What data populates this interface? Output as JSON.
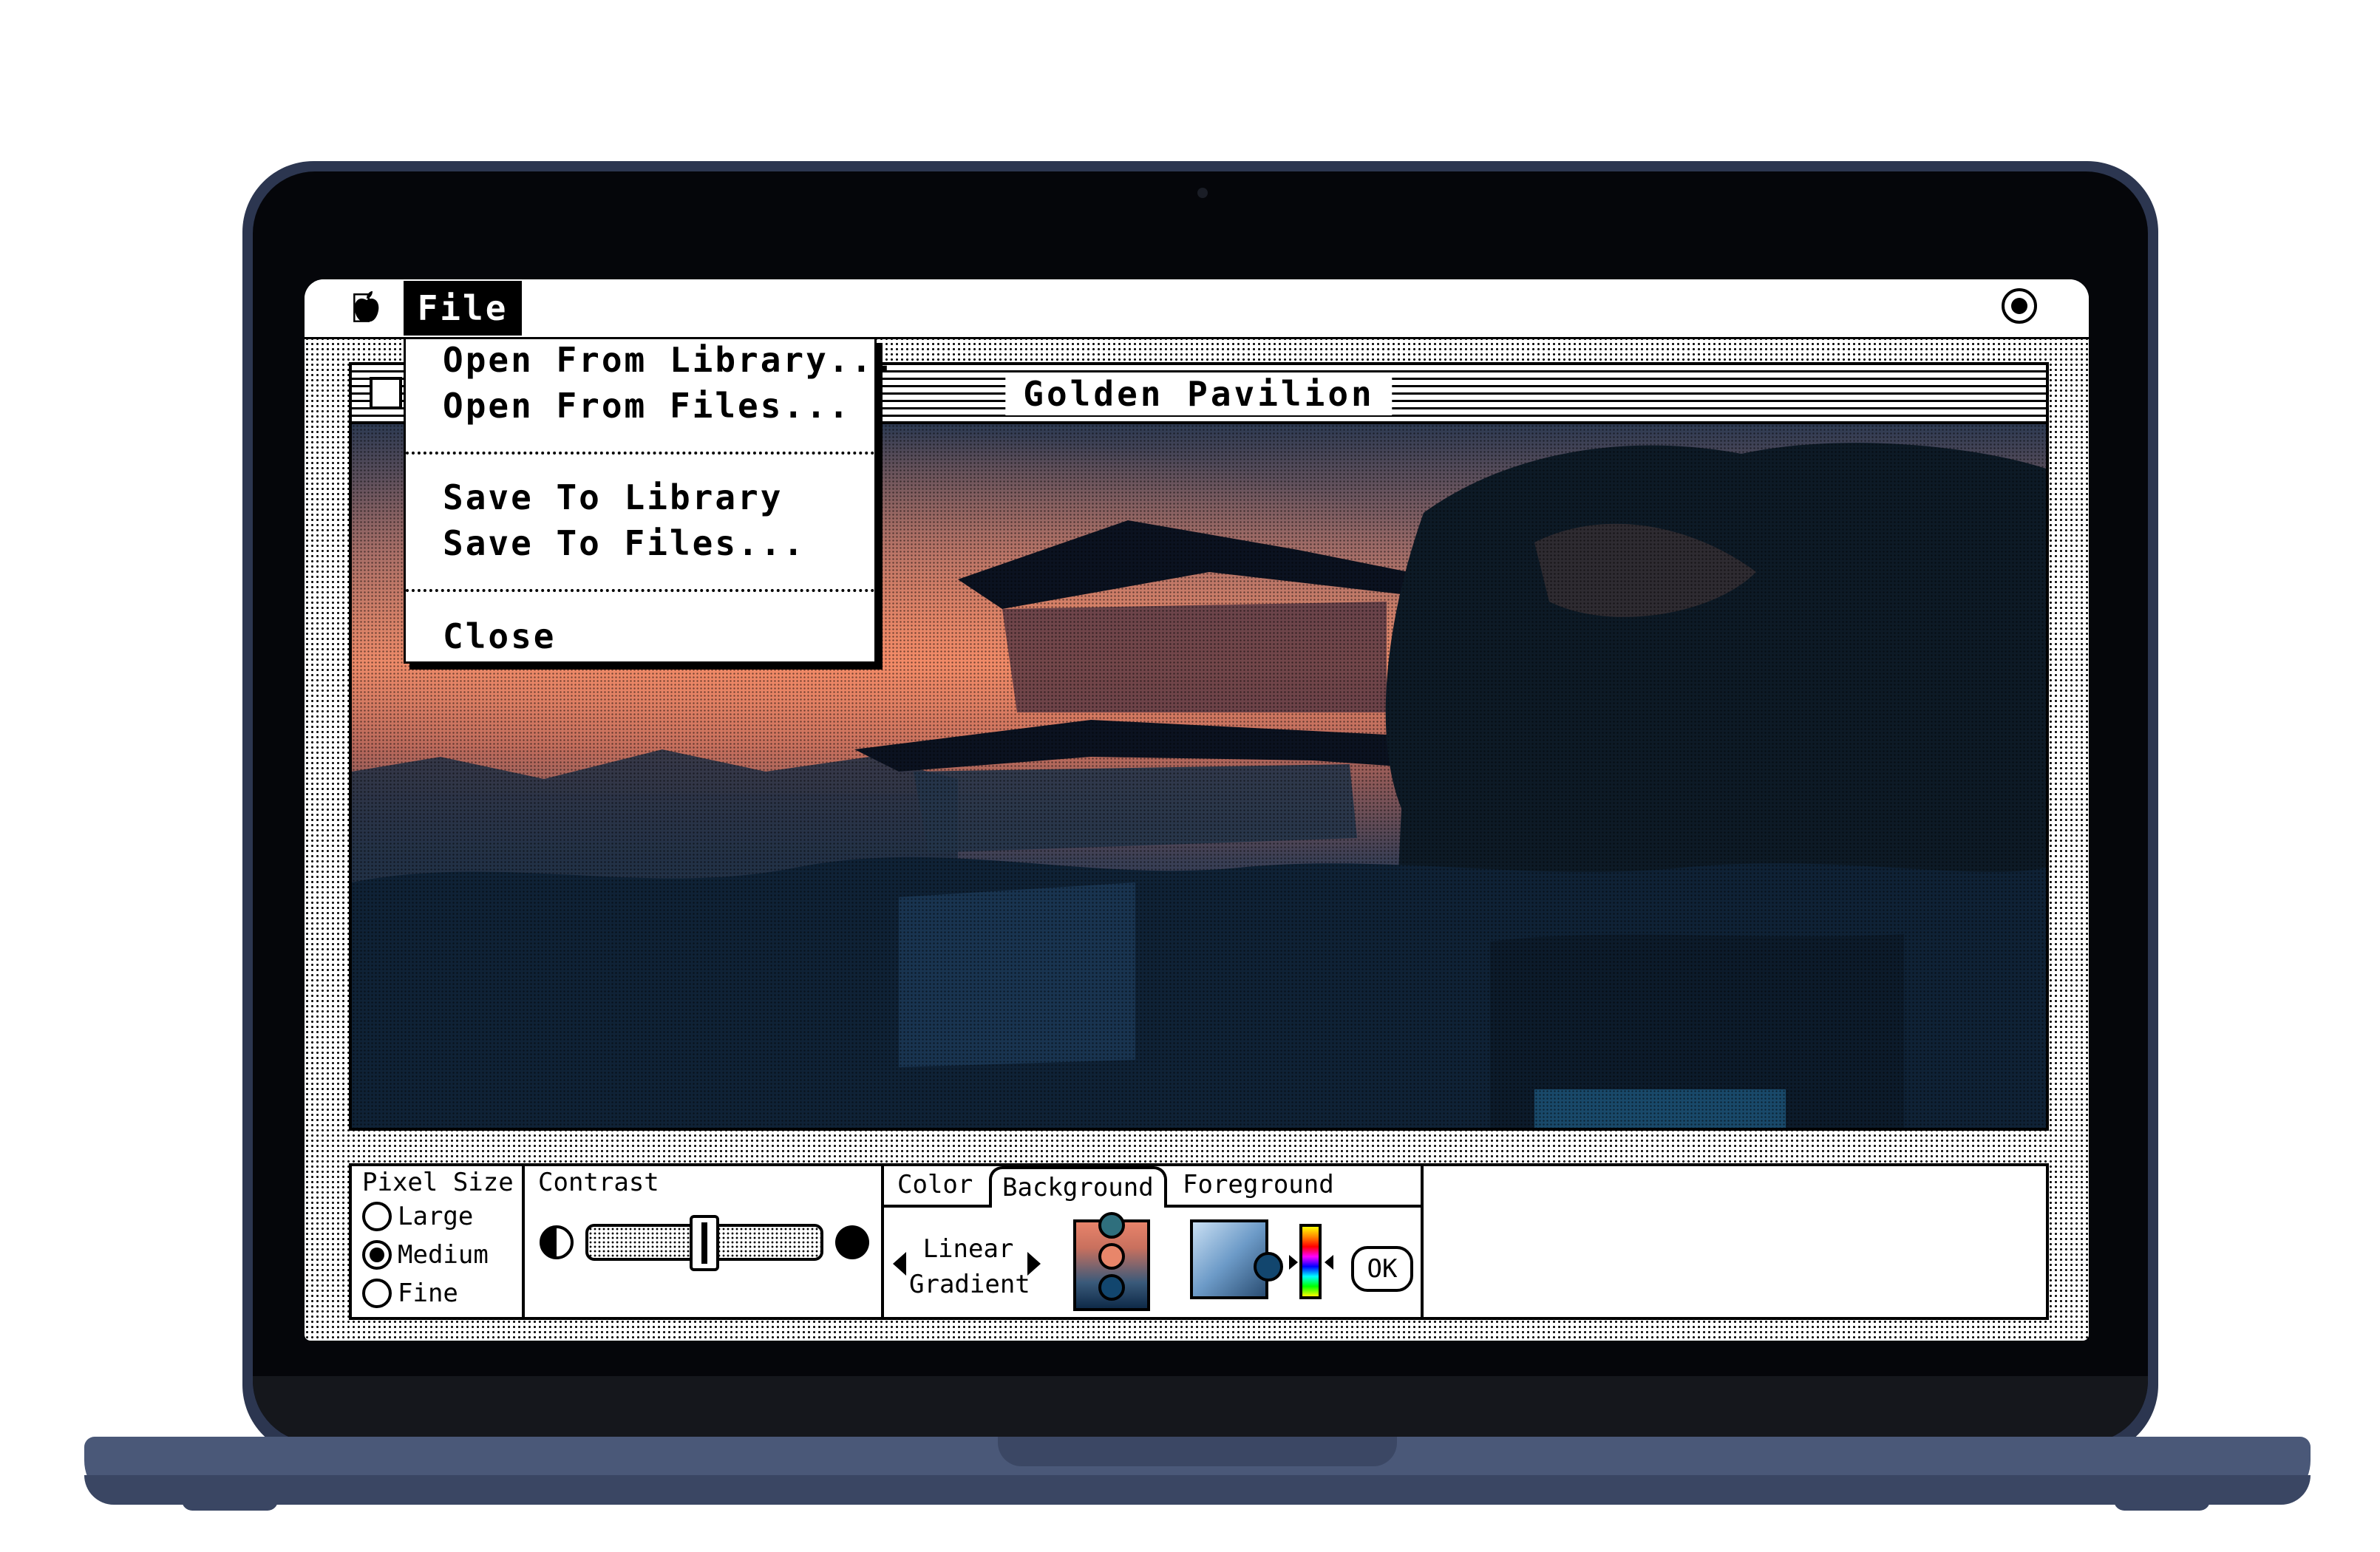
{
  "menubar": {
    "apple_icon": "apple-icon",
    "file_menu": "File",
    "right_icon": "target-icon"
  },
  "file_menu": {
    "items": [
      "Open From Library...",
      "Open From Files...",
      "Save To Library",
      "Save To Files...",
      "Close"
    ]
  },
  "window": {
    "title": "Golden Pavilion"
  },
  "controls": {
    "pixel_size": {
      "label": "Pixel Size",
      "options": [
        "Large",
        "Medium",
        "Fine"
      ],
      "selected": "Medium"
    },
    "contrast": {
      "label": "Contrast",
      "value_fraction": 0.5
    },
    "color": {
      "label": "Color",
      "tabs": [
        "Background",
        "Foreground"
      ],
      "active_tab": "Background",
      "gradient_line1": "Linear",
      "gradient_line2": "Gradient",
      "ok_label": "OK",
      "gradient_stops": [
        "#2f6f7d",
        "#e8866a",
        "#12466e"
      ],
      "foreground_color": "#12466e"
    }
  }
}
